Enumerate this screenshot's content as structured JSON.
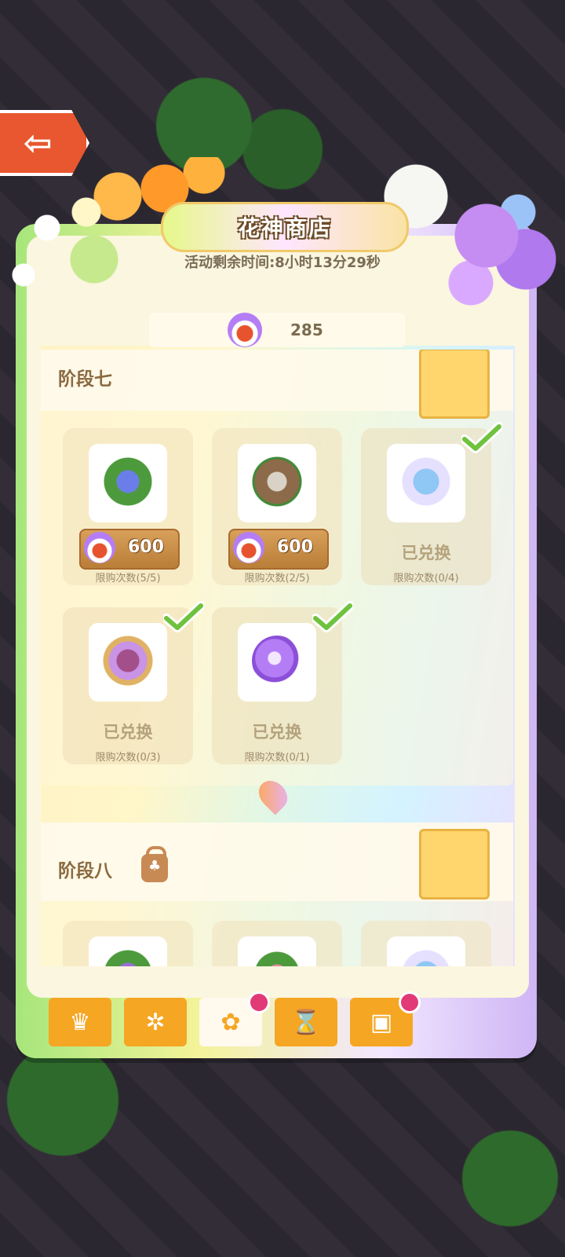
{
  "header": {
    "back_label": "⇦",
    "title": "花神商店",
    "timer": "活动剩余时间:8小时13分29秒"
  },
  "currency": {
    "icon": "flower-token-icon",
    "value": "285"
  },
  "stage7": {
    "title": "阶段七",
    "items": [
      {
        "name": "blue-flower-trellis",
        "price": "600",
        "limit": "限购次数(5/5)",
        "status": ""
      },
      {
        "name": "tub-fountain",
        "price": "600",
        "limit": "限购次数(2/5)",
        "status": ""
      },
      {
        "name": "blue-flower-cake",
        "price": "",
        "limit": "限购次数(0/4)",
        "status": "已兑换"
      },
      {
        "name": "flower-basket",
        "price": "",
        "limit": "限购次数(0/3)",
        "status": "已兑换"
      },
      {
        "name": "purple-orb",
        "price": "",
        "limit": "限购次数(0/1)",
        "status": "已兑换"
      }
    ]
  },
  "stage8": {
    "title": "阶段八",
    "locked": true
  },
  "tabs": [
    "crown",
    "pinwheel",
    "shop",
    "hourglass",
    "gift"
  ],
  "colors": {
    "accent": "#f5a623",
    "text_brown": "#8a6a40",
    "notif": "#e23a76"
  }
}
